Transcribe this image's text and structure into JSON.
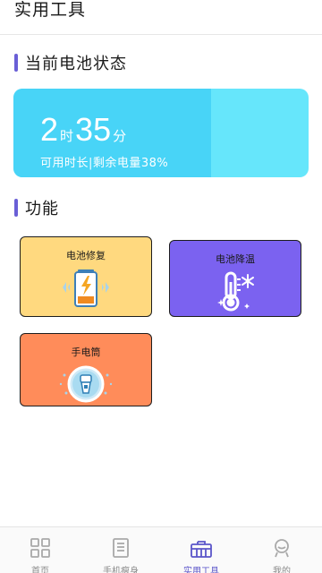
{
  "header": {
    "title": "实用工具"
  },
  "battery_section": {
    "heading": "当前电池状态",
    "hours": "2",
    "hour_unit": "时",
    "minutes": "35",
    "minute_unit": "分",
    "description": "可用时长|剩余电量38%",
    "level": 0.67
  },
  "features_section": {
    "heading": "功能",
    "tools": [
      {
        "label": "电池修复",
        "icon": "battery-repair-icon",
        "color": "#ffd97f"
      },
      {
        "label": "电池降温",
        "icon": "thermometer-snow-icon",
        "color": "#7b62f0"
      },
      {
        "label": "手电筒",
        "icon": "flashlight-icon",
        "color": "#ff8c5a"
      }
    ]
  },
  "bottom_nav": {
    "items": [
      {
        "label": "首页",
        "icon": "home-grid-icon"
      },
      {
        "label": "手机瘦身",
        "icon": "document-icon"
      },
      {
        "label": "实用工具",
        "icon": "toolbox-icon",
        "active": true
      },
      {
        "label": "我的",
        "icon": "profile-icon"
      }
    ]
  },
  "colors": {
    "accent": "#6a5fd6",
    "battery_card": "#66e6fb",
    "battery_fill": "#48d4f7"
  }
}
